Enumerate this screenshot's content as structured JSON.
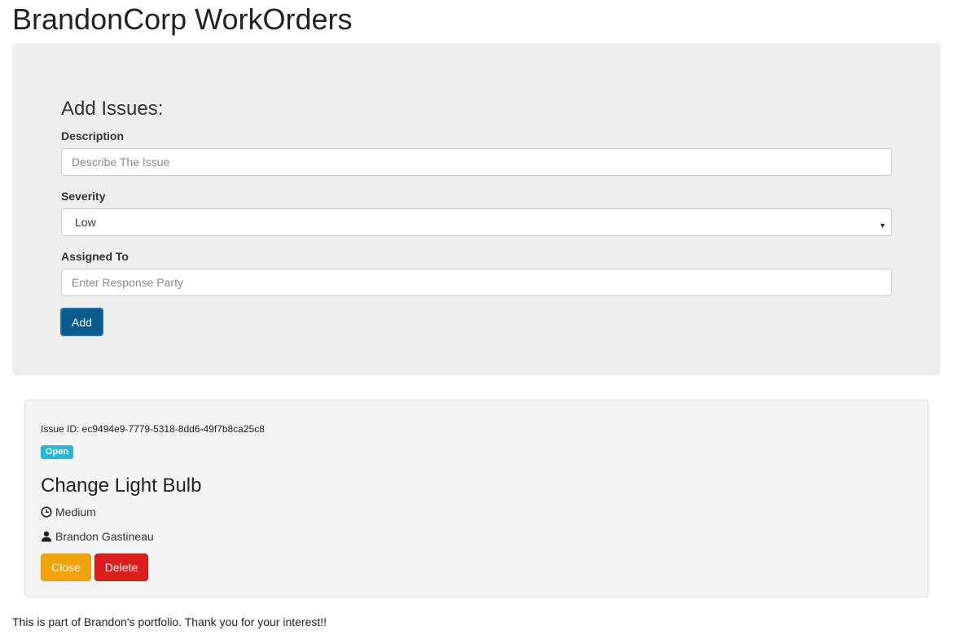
{
  "app": {
    "title": "BrandonCorp WorkOrders"
  },
  "form": {
    "heading": "Add Issues:",
    "description_label": "Description",
    "description_placeholder": "Describe The Issue",
    "severity_label": "Severity",
    "severity_selected": "Low",
    "assigned_label": "Assigned To",
    "assigned_placeholder": "Enter Response Party",
    "add_button": "Add"
  },
  "issue": {
    "id_text": "Issue ID: ec9494e9-7779-5318-8dd6-49f7b8ca25c8",
    "status": "Open",
    "title": "Change Light Bulb",
    "severity": "Medium",
    "assignee": "Brandon Gastineau",
    "close_button": "Close",
    "delete_button": "Delete"
  },
  "footer": {
    "note": "This is part of Brandon's portfolio. Thank you for your interest!!"
  },
  "colors": {
    "primary_button": "#0b5a8d",
    "warning_button": "#f0a30a",
    "danger_button": "#db1f1f",
    "status_badge": "#25b6d9",
    "jumbotron_bg": "#eeeeee"
  },
  "icons": {
    "severity": "clock-icon",
    "assignee": "user-icon",
    "select": "chevron-down-icon"
  }
}
